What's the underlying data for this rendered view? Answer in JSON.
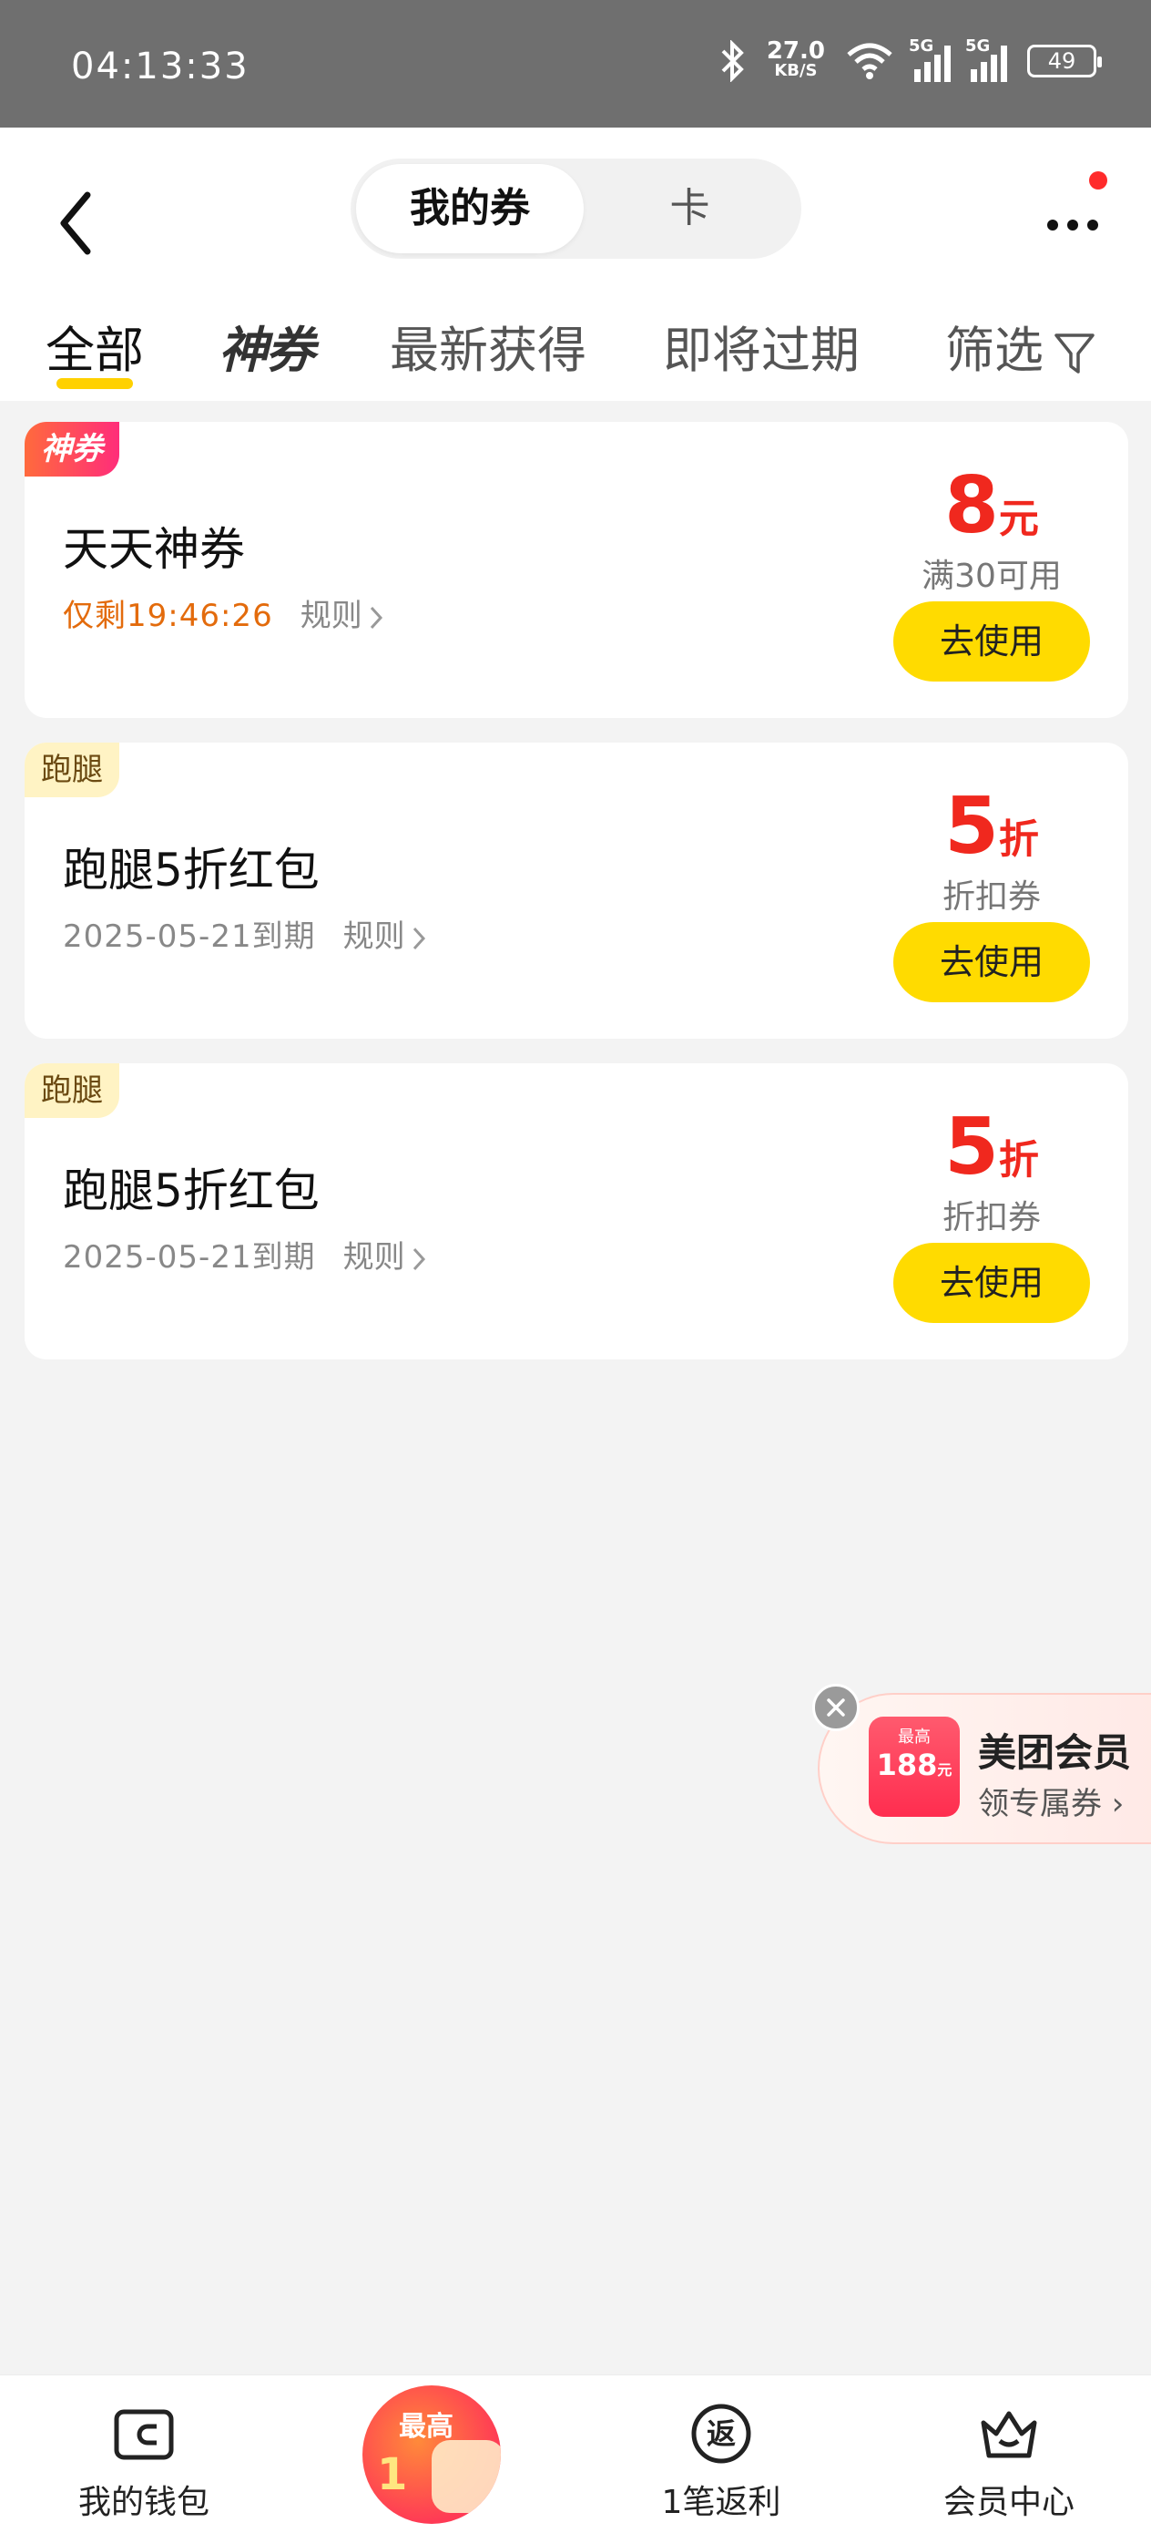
{
  "status_bar": {
    "time": "04:13:33",
    "speed_value": "27.0",
    "speed_unit": "KB/S",
    "net1": "5G",
    "net2": "5G",
    "battery": "49"
  },
  "header": {
    "segment": {
      "active": "我的券",
      "inactive": "卡"
    },
    "tabs": [
      {
        "label": "全部"
      },
      {
        "label": "神券"
      },
      {
        "label": "最新获得"
      },
      {
        "label": "即将过期"
      },
      {
        "label": "筛选"
      }
    ]
  },
  "coupons": [
    {
      "tag": "神券",
      "title": "天天神券",
      "countdown": "仅剩19:46:26",
      "rule": "规则",
      "amount": "8",
      "unit": "元",
      "condition": "满30可用",
      "button": "去使用"
    },
    {
      "tag": "跑腿",
      "title": "跑腿5折红包",
      "expiry": "2025-05-21到期",
      "rule": "规则",
      "amount": "5",
      "unit": "折",
      "condition": "折扣券",
      "button": "去使用"
    },
    {
      "tag": "跑腿",
      "title": "跑腿5折红包",
      "expiry": "2025-05-21到期",
      "rule": "规则",
      "amount": "5",
      "unit": "折",
      "condition": "折扣券",
      "button": "去使用"
    }
  ],
  "float_ad": {
    "badge_top": "最高",
    "badge_amount": "188",
    "badge_unit": "元",
    "title": "美团会员",
    "subtitle": "领专属券 ›"
  },
  "bottom_nav": {
    "items": [
      {
        "label": "我的钱包"
      },
      {
        "label": "1笔返利"
      },
      {
        "label": "会员中心"
      }
    ],
    "promo": {
      "top": "最高",
      "bottom": "1"
    }
  },
  "colors": {
    "accent": "#ffdb00",
    "price": "#f0281e",
    "countdown": "#e36b0c"
  }
}
